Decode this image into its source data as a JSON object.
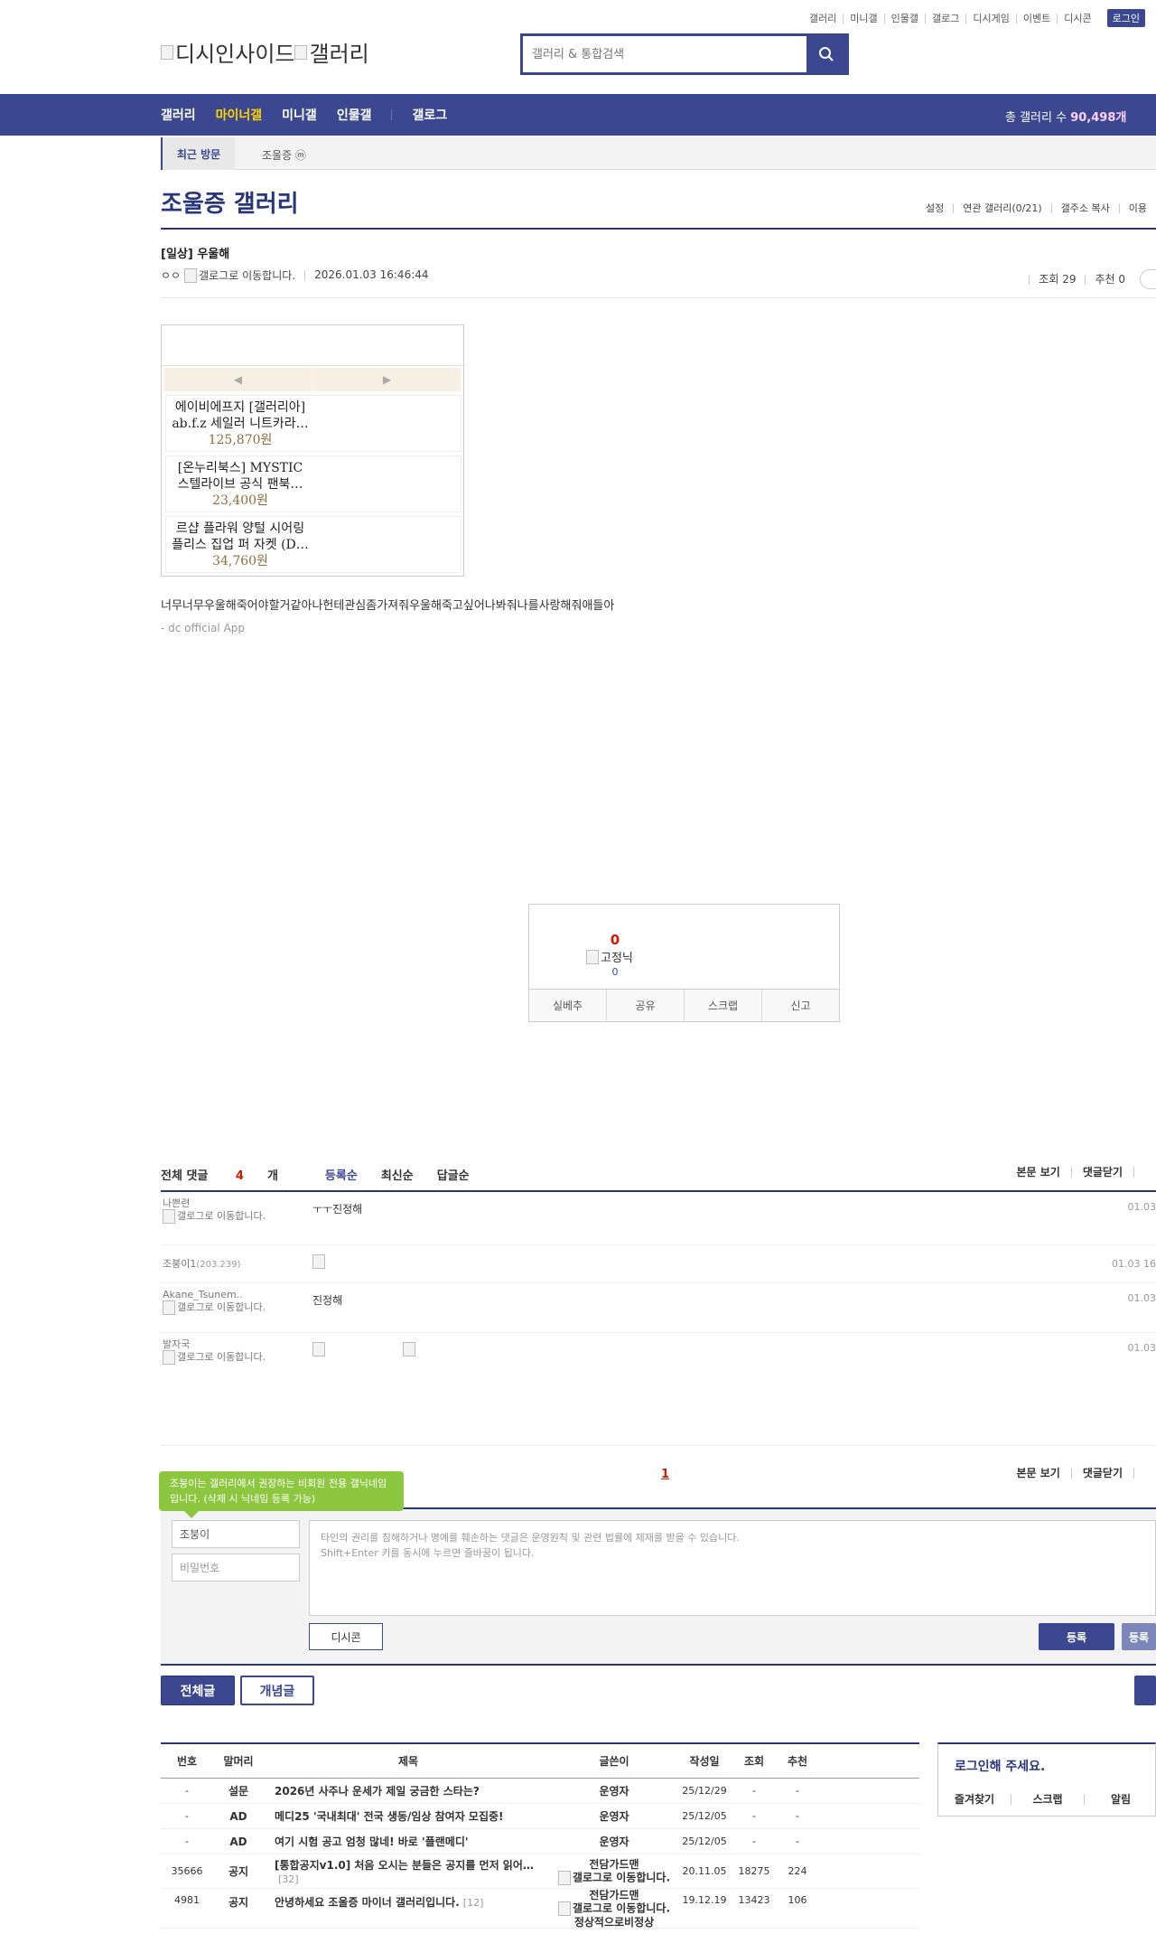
{
  "util_nav": [
    "갤러리",
    "미니갤",
    "인물갤",
    "갤로그",
    "디시게임",
    "이벤트",
    "디시콘"
  ],
  "login_button": "로그인",
  "logo": {
    "site_alt": "디시인사이드",
    "gallery_alt": "갤러리"
  },
  "search": {
    "placeholder": "갤러리 & 통합검색"
  },
  "gnb": {
    "items": [
      "갤러리",
      "마이너갤",
      "미니갤",
      "인물갤",
      "갤로그"
    ],
    "total_label": "총 갤러리 수",
    "total_value": "90,498개",
    "active_color": "#ffd400"
  },
  "recent": {
    "label": "최근 방문",
    "gallery": "조울증 ⓜ"
  },
  "gallery": {
    "title": "조울증 갤러리",
    "menu": [
      "설정",
      "연관 갤러리(0/21)",
      "갤주소 복사",
      "이용"
    ]
  },
  "post": {
    "title": "[일상] 우울해",
    "author": "ㅇㅇ",
    "author_img_alt": "갤로그로 이동합니다.",
    "date": "2026.01.03 16:46:44",
    "views": "조회 29",
    "recommend": "추천 0",
    "body": "너무너무우울해죽어야할거같아나헌테관심좀가져줘우울해죽고싶어나봐줘나를사랑해줘애들아",
    "app_signature": "- dc official App"
  },
  "ad": {
    "prev": "◀",
    "next": "▶",
    "products": [
      {
        "name": "에이비에프지 [갤러리아] ab.f.z 세일러 니트카라…",
        "price": "125,870원"
      },
      {
        "name": "[온누리북스] MYSTIC 스텔라이브 공식 팬북…",
        "price": "23,400원"
      },
      {
        "name": "르샵 플라워 양털 시어링 플리스 집업 퍼 자켓 (D…",
        "price": "34,760원"
      }
    ]
  },
  "vote": {
    "count": "0",
    "fixed_nick_alt": "고정닉",
    "fixed_count": "0",
    "buttons": [
      "실베추",
      "공유",
      "스크랩",
      "신고"
    ]
  },
  "comments": {
    "total_label": "전체 댓글",
    "total_count": "4",
    "total_unit": "개",
    "sort_tabs": [
      "등록순",
      "최신순",
      "답글순"
    ],
    "right_links": [
      "본문 보기",
      "댓글닫기"
    ],
    "items": [
      {
        "nick": "나쁜련",
        "img_alt": "갤로그로 이동합니다.",
        "text": "ㅜㅜ진정해",
        "date": "01.03"
      },
      {
        "nick": "조붕이1",
        "ip": "(203.239)",
        "img_alt": "",
        "text": "",
        "date": "01.03 16"
      },
      {
        "nick": "Akane_Tsunem..",
        "img_alt": "갤로그로 이동합니다.",
        "text": "진정해",
        "date": "01.03"
      },
      {
        "nick": "발자국",
        "img_alt": "갤로그로 이동합니다.",
        "text": "",
        "date": "01.03"
      }
    ],
    "page": "1"
  },
  "comment_form": {
    "tooltip": "조붕이는 갤러리에서 권장하는 비회원 전용 갤닉네임입니다. (삭제 시 닉네임 등록 가능)",
    "nick_value": "조붕이",
    "password_placeholder": "비밀번호",
    "textarea_line1": "타인의 권리를 침해하거나 명예를 훼손하는 댓글은 운영원칙 및 관련 법률에 제재를 받을 수 있습니다.",
    "textarea_line2": "Shift+Enter 키를 동시에 누르면 줄바꿈이 됩니다.",
    "dccon_label": "디시콘",
    "submit_label": "등록",
    "submit2_label": "등록"
  },
  "list_buttons": {
    "all": "전체글",
    "concept": "개념글"
  },
  "table": {
    "headers": [
      "번호",
      "말머리",
      "제목",
      "글쓴이",
      "작성일",
      "조회",
      "추천"
    ],
    "rows": [
      {
        "num": "-",
        "tag": "설문",
        "title": "2026년 사주나 운세가 제일 궁금한 스타는?",
        "count": "",
        "writer": "운영자",
        "date": "25/12/29",
        "views": "-",
        "rec": "-"
      },
      {
        "num": "-",
        "tag": "AD",
        "title": "메디25 '국내최대' 전국 생동/임상 참여자 모집중!",
        "count": "",
        "writer": "운영자",
        "date": "25/12/05",
        "views": "-",
        "rec": "-"
      },
      {
        "num": "-",
        "tag": "AD",
        "title": "여기 시험 공고 엄청 많네! 바로 '플랜메디'",
        "count": "",
        "writer": "운영자",
        "date": "25/12/05",
        "views": "-",
        "rec": "-"
      },
      {
        "num": "35666",
        "tag": "공지",
        "title": "[통합공지v1.0] 처음 오시는 분들은 공지를 먼저 읽어…",
        "count": "[32]",
        "writer": "전담가드맨",
        "date": "20.11.05",
        "views": "18275",
        "rec": "224"
      },
      {
        "num": "4981",
        "tag": "공지",
        "title": "안녕하세요 조울증 마이너 갤러리입니다.",
        "count": "[12]",
        "writer": "전담가드맨",
        "date": "19.12.19",
        "views": "13423",
        "rec": "106"
      }
    ],
    "writer_img_alt": "갤로그로 이동합니다.",
    "last_writer_extra": "정상적으로비정상"
  },
  "side": {
    "login_prompt": "로그인해 주세요.",
    "links": [
      "즐겨찾기",
      "스크랩",
      "알림"
    ]
  }
}
